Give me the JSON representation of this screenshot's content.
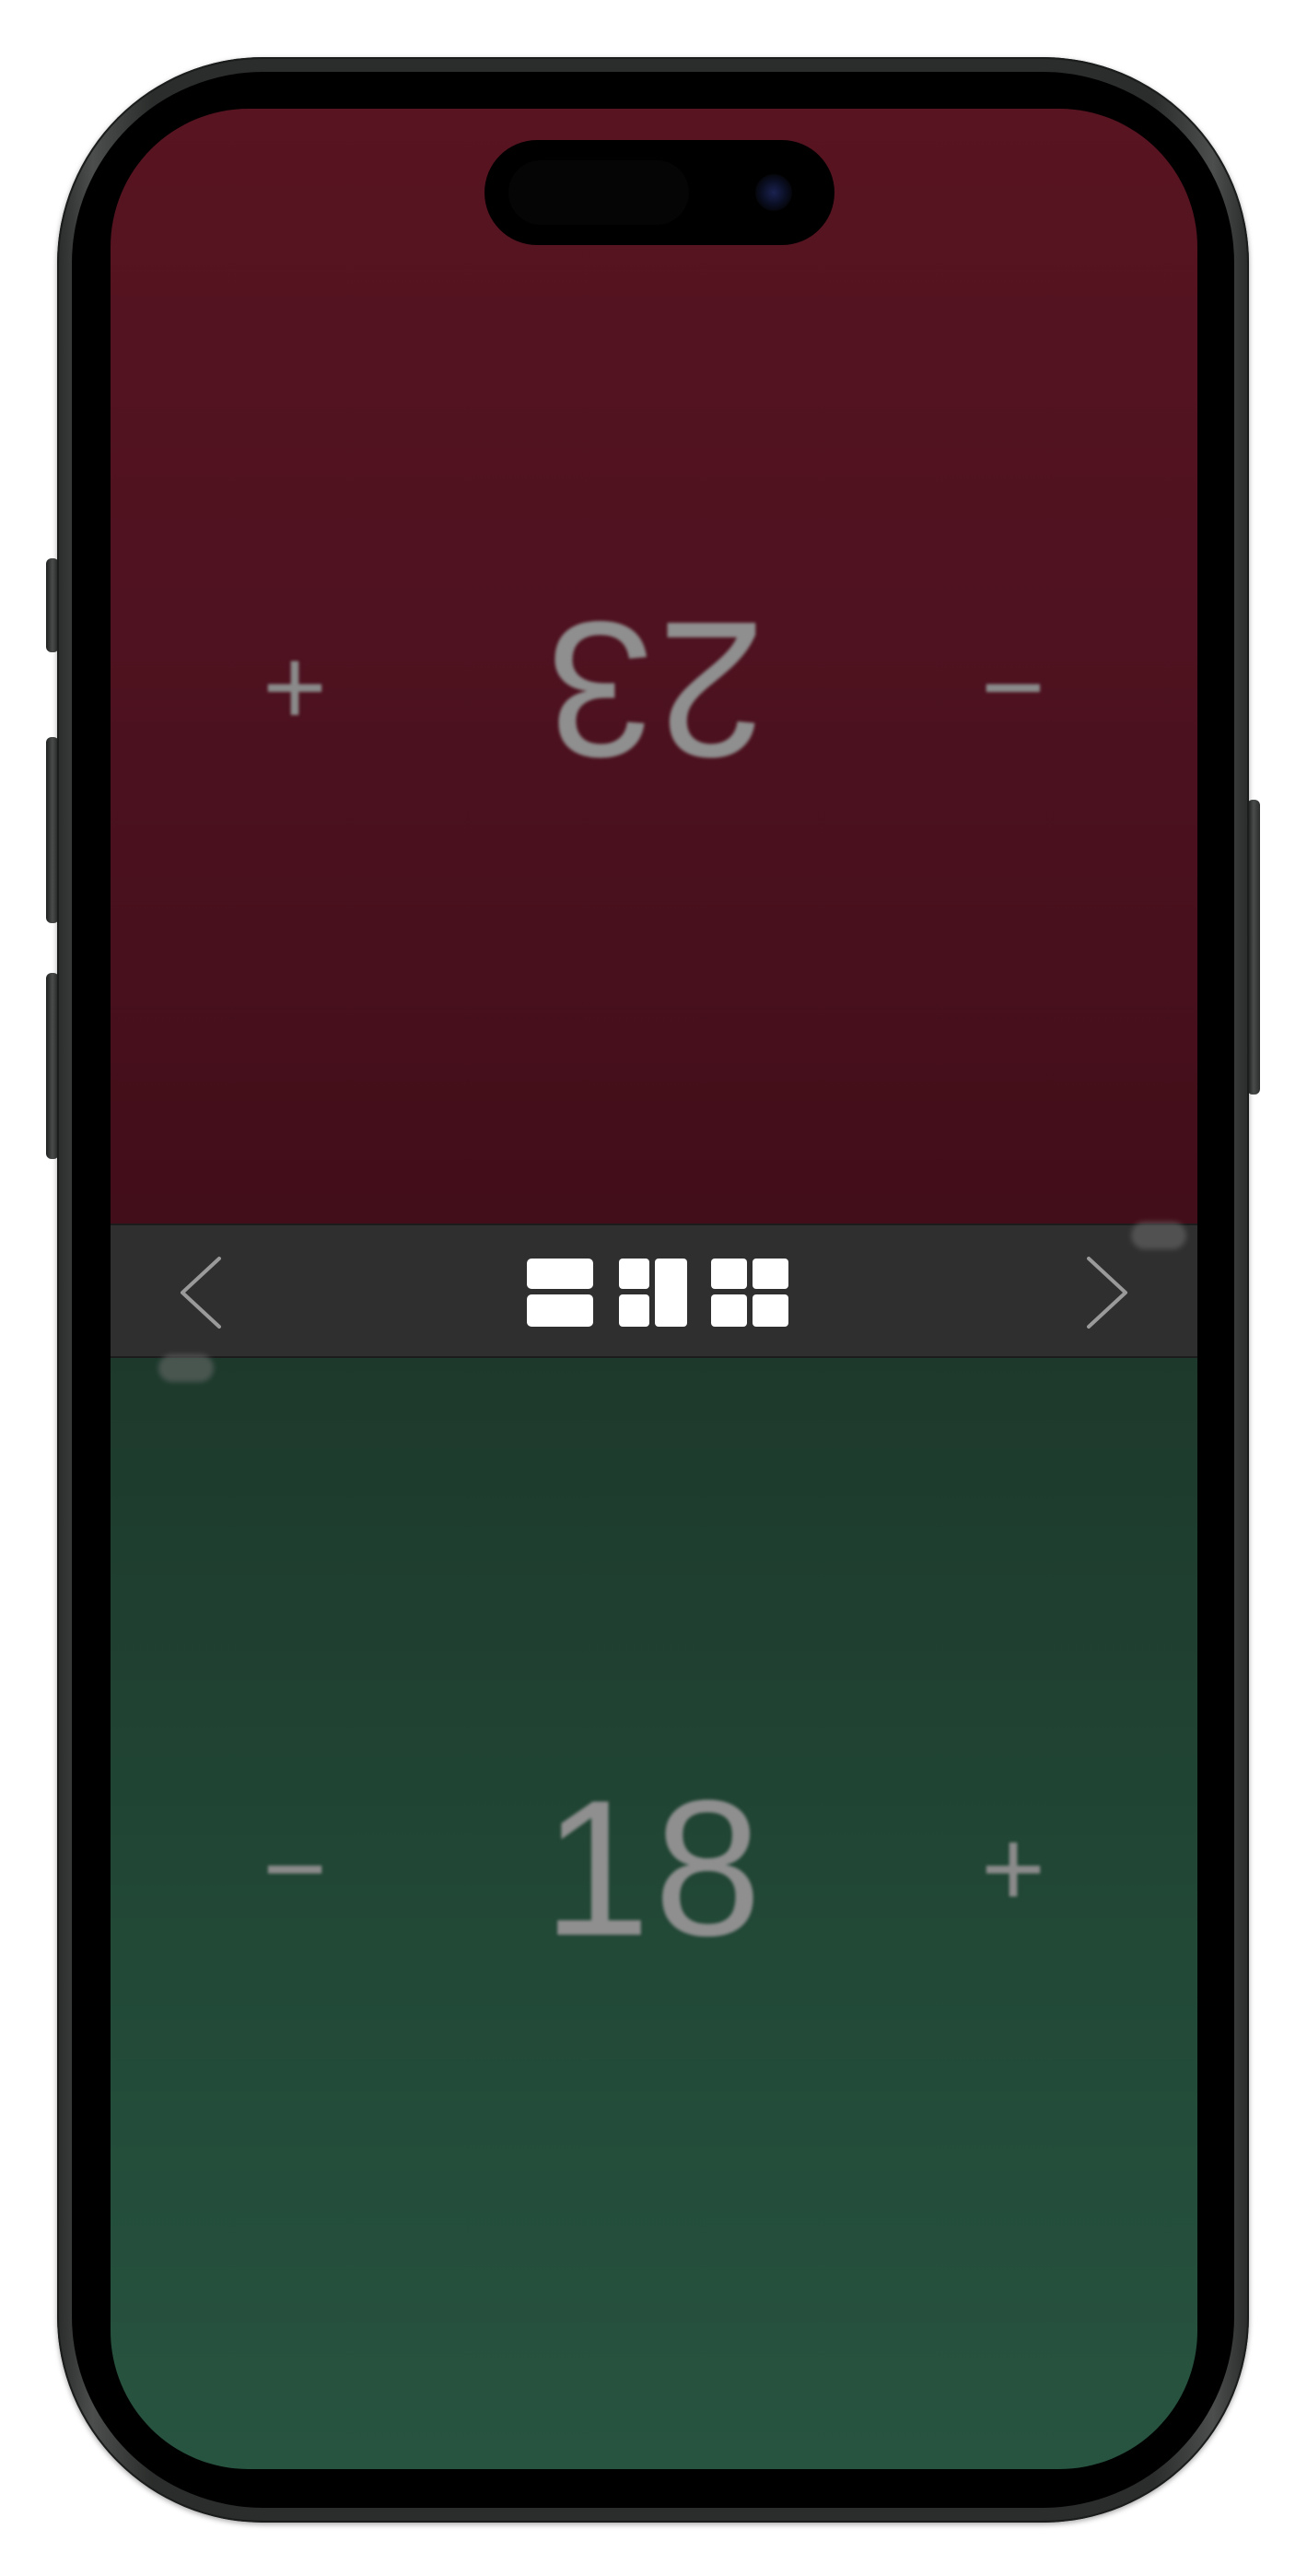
{
  "players": {
    "top": {
      "life": "23",
      "plus_label": "+",
      "minus_label": "−",
      "color": "#501220"
    },
    "bottom": {
      "life": "18",
      "plus_label": "+",
      "minus_label": "−",
      "color": "#224836"
    }
  },
  "controls": {
    "prev_icon": "chevron-left-icon",
    "next_icon": "chevron-right-icon",
    "layouts": [
      "two-player-horizontal-layout",
      "three-player-layout",
      "four-player-grid-layout"
    ],
    "bar_color": "#2f2f2f"
  }
}
